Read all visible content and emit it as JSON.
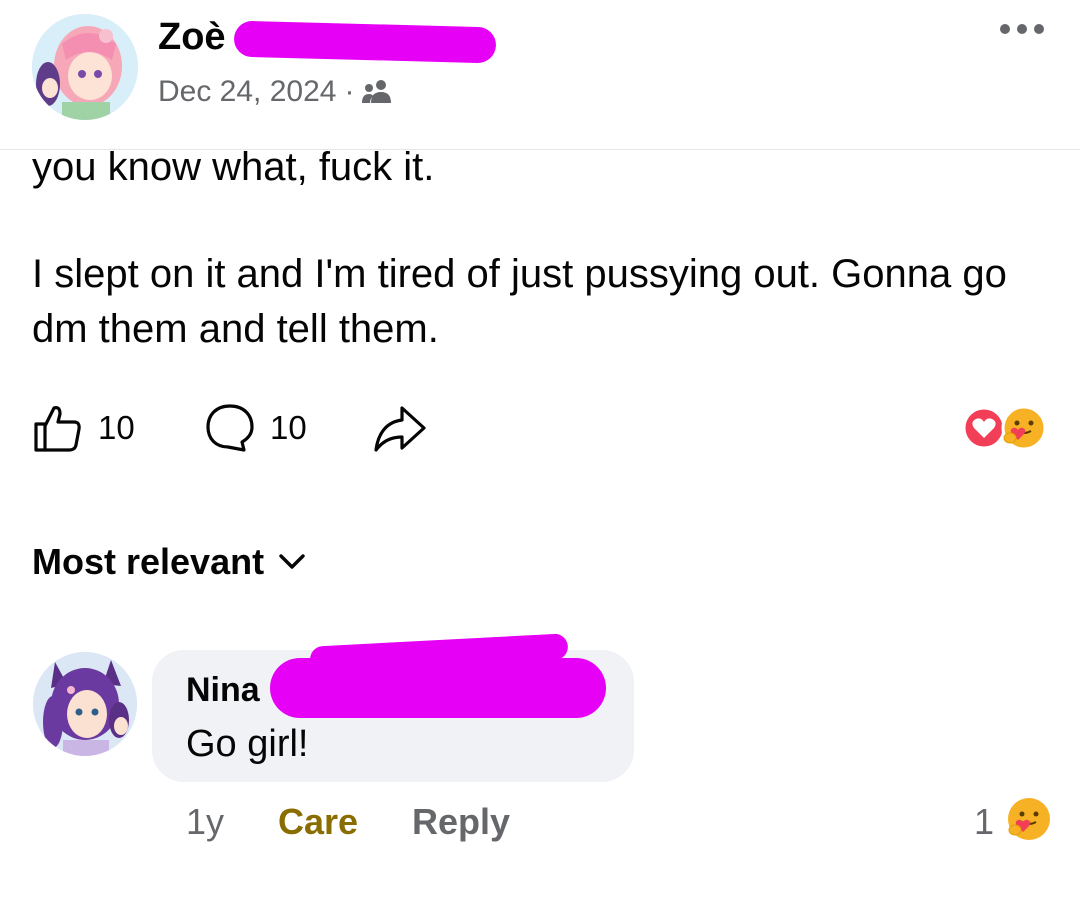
{
  "post": {
    "author_name": "Zoè",
    "date": "Dec 24, 2024",
    "separator": "·",
    "privacy_icon": "friends-icon",
    "more_icon": "more-horizontal-icon",
    "body_lines": [
      "you know what, fuck it.",
      "I slept on it and I'm tired of just pussying out. Gonna go dm them and tell them."
    ],
    "like_count": "10",
    "comment_count": "10",
    "reaction_icons": [
      "love-reaction-icon",
      "care-reaction-icon"
    ]
  },
  "comments": {
    "sort_label": "Most relevant",
    "items": [
      {
        "author_name": "Nina",
        "text": "Go girl!",
        "time": "1y",
        "reaction_label": "Care",
        "reply_label": "Reply",
        "reaction_count": "1",
        "reaction_icon": "care-reaction-icon"
      }
    ]
  },
  "colors": {
    "redaction": "#e600f5",
    "secondary_text": "#65676b",
    "care_text": "#8a6d00",
    "bubble": "#f0f2f5",
    "love_red": "#f33e58",
    "care_yellow": "#f7b125"
  }
}
